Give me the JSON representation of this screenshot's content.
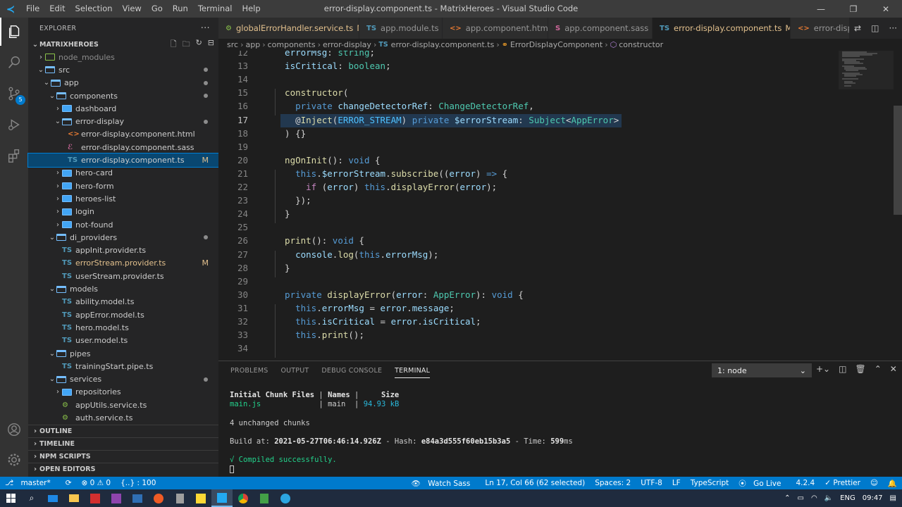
{
  "window": {
    "title": "error-display.component.ts - MatrixHeroes - Visual Studio Code",
    "menu": [
      "File",
      "Edit",
      "Selection",
      "View",
      "Go",
      "Run",
      "Terminal",
      "Help"
    ],
    "controls": [
      "—",
      "❐",
      "✕"
    ]
  },
  "sidebar": {
    "header": "EXPLORER",
    "root": "MATRIXHEROES",
    "tree": [
      {
        "label": "node_modules",
        "indent": 1,
        "kind": "folder-green",
        "chev": "›",
        "dimmed": true
      },
      {
        "label": "src",
        "indent": 1,
        "kind": "folder-open",
        "chev": "⌄",
        "dot": true
      },
      {
        "label": "app",
        "indent": 2,
        "kind": "folder-open",
        "chev": "⌄",
        "dot": true
      },
      {
        "label": "components",
        "indent": 3,
        "kind": "folder-open",
        "chev": "⌄",
        "dot": true
      },
      {
        "label": "dashboard",
        "indent": 4,
        "kind": "folder",
        "chev": "›"
      },
      {
        "label": "error-display",
        "indent": 4,
        "kind": "folder-open",
        "chev": "⌄",
        "dot": true
      },
      {
        "label": "error-display.component.html",
        "indent": 5,
        "kind": "html"
      },
      {
        "label": "error-display.component.sass",
        "indent": 5,
        "kind": "sass"
      },
      {
        "label": "error-display.component.ts",
        "indent": 5,
        "kind": "ts",
        "badge": "M",
        "selected": true
      },
      {
        "label": "hero-card",
        "indent": 4,
        "kind": "folder",
        "chev": "›"
      },
      {
        "label": "hero-form",
        "indent": 4,
        "kind": "folder",
        "chev": "›"
      },
      {
        "label": "heroes-list",
        "indent": 4,
        "kind": "folder",
        "chev": "›"
      },
      {
        "label": "login",
        "indent": 4,
        "kind": "folder",
        "chev": "›"
      },
      {
        "label": "not-found",
        "indent": 4,
        "kind": "folder",
        "chev": "›"
      },
      {
        "label": "di_providers",
        "indent": 3,
        "kind": "folder-open",
        "chev": "⌄",
        "dot": true
      },
      {
        "label": "appInit.provider.ts",
        "indent": 4,
        "kind": "ts"
      },
      {
        "label": "errorStream.provider.ts",
        "indent": 4,
        "kind": "ts",
        "badge": "M",
        "modified": true
      },
      {
        "label": "userStream.provider.ts",
        "indent": 4,
        "kind": "ts"
      },
      {
        "label": "models",
        "indent": 3,
        "kind": "folder-open",
        "chev": "⌄"
      },
      {
        "label": "ability.model.ts",
        "indent": 4,
        "kind": "ts"
      },
      {
        "label": "appError.model.ts",
        "indent": 4,
        "kind": "ts"
      },
      {
        "label": "hero.model.ts",
        "indent": 4,
        "kind": "ts"
      },
      {
        "label": "user.model.ts",
        "indent": 4,
        "kind": "ts"
      },
      {
        "label": "pipes",
        "indent": 3,
        "kind": "folder-open",
        "chev": "⌄"
      },
      {
        "label": "trainingStart.pipe.ts",
        "indent": 4,
        "kind": "ts"
      },
      {
        "label": "services",
        "indent": 3,
        "kind": "folder-open",
        "chev": "⌄",
        "dot": true
      },
      {
        "label": "repositories",
        "indent": 4,
        "kind": "folder",
        "chev": "›"
      },
      {
        "label": "appUtils.service.ts",
        "indent": 4,
        "kind": "service"
      },
      {
        "label": "auth.service.ts",
        "indent": 4,
        "kind": "service"
      }
    ],
    "sections": [
      "OUTLINE",
      "TIMELINE",
      "NPM SCRIPTS",
      "OPEN EDITORS"
    ]
  },
  "tabs": [
    {
      "label": "globalErrorHandler.service.ts",
      "icon": "⚙",
      "iconColor": "#8bc34a",
      "mod": "M"
    },
    {
      "label": "app.module.ts",
      "icon": "TS",
      "iconColor": "#519aba"
    },
    {
      "label": "app.component.html",
      "icon": "<>",
      "iconColor": "#e37933"
    },
    {
      "label": "app.component.sass",
      "icon": "S",
      "iconColor": "#cd6799"
    },
    {
      "label": "error-display.component.ts",
      "icon": "TS",
      "iconColor": "#519aba",
      "mod": "M",
      "active": true
    },
    {
      "label": "error-display",
      "icon": "<>",
      "iconColor": "#e37933"
    }
  ],
  "breadcrumb": [
    "src",
    "app",
    "components",
    "error-display",
    "error-display.component.ts",
    "ErrorDisplayComponent",
    "constructor"
  ],
  "editor": {
    "first_line": 12,
    "current_line": 17
  },
  "panel": {
    "tabs": [
      "PROBLEMS",
      "OUTPUT",
      "DEBUG CONSOLE",
      "TERMINAL"
    ],
    "active_tab": "TERMINAL",
    "terminal_select": "1: node",
    "term": {
      "h_files": "Initial Chunk Files",
      "h_names": "Names",
      "h_size": "Size",
      "file": "main.js",
      "name": "main",
      "size": "94.93 kB",
      "unchanged": "4 unchanged chunks",
      "build_label": "Build at: ",
      "build_time": "2021-05-27T06:46:14.926Z",
      "hash_label": " - Hash: ",
      "hash": "e84a3d555f60eb15b3a5",
      "time_label": " - Time: ",
      "time": "599",
      "time_unit": "ms",
      "compiled": "√ Compiled successfully."
    }
  },
  "status": {
    "branch": "master*",
    "sync": "⟳",
    "problems": "⊗ 0 ⚠ 0",
    "tags": "{..} : 100",
    "watch_sass": "Watch Sass",
    "position": "Ln 17, Col 66 (62 selected)",
    "spaces": "Spaces: 2",
    "encoding": "UTF-8",
    "eol": "LF",
    "language": "TypeScript",
    "golive": "Go Live",
    "version": "4.2.4",
    "prettier": "✓ Prettier"
  },
  "taskbar": {
    "lang": "ENG",
    "time": "09:47"
  },
  "colors": {
    "statusbar": "#007acc",
    "selection": "#094771",
    "accent": "#23a9f2"
  }
}
